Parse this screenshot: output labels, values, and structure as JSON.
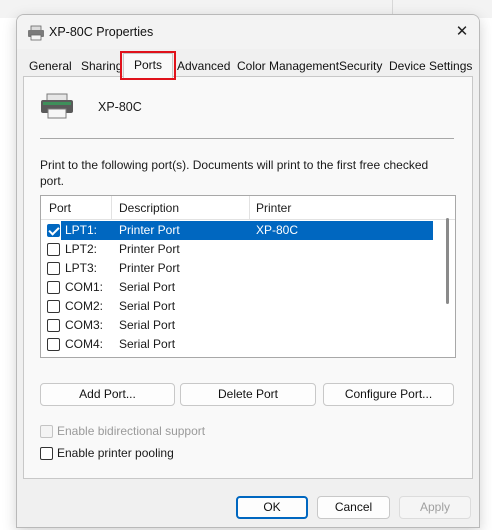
{
  "window": {
    "title": "XP-80C Properties",
    "close_glyph": "✕"
  },
  "tabs": [
    {
      "label": "General",
      "active": false
    },
    {
      "label": "Sharing",
      "active": false
    },
    {
      "label": "Ports",
      "active": true
    },
    {
      "label": "Advanced",
      "active": false
    },
    {
      "label": "Color Management",
      "active": false
    },
    {
      "label": "Security",
      "active": false
    },
    {
      "label": "Device Settings",
      "active": false
    }
  ],
  "highlight_color": "#e0121b",
  "accent_color": "#0067c0",
  "printer": {
    "name": "XP-80C",
    "icon": "printer-icon"
  },
  "description": "Print to the following port(s). Documents will print to the first free checked port.",
  "ports_table": {
    "headers": {
      "port": "Port",
      "description": "Description",
      "printer": "Printer"
    },
    "rows": [
      {
        "port": "LPT1:",
        "description": "Printer Port",
        "printer": "XP-80C",
        "checked": true,
        "selected": true
      },
      {
        "port": "LPT2:",
        "description": "Printer Port",
        "printer": "",
        "checked": false,
        "selected": false
      },
      {
        "port": "LPT3:",
        "description": "Printer Port",
        "printer": "",
        "checked": false,
        "selected": false
      },
      {
        "port": "COM1:",
        "description": "Serial Port",
        "printer": "",
        "checked": false,
        "selected": false
      },
      {
        "port": "COM2:",
        "description": "Serial Port",
        "printer": "",
        "checked": false,
        "selected": false
      },
      {
        "port": "COM3:",
        "description": "Serial Port",
        "printer": "",
        "checked": false,
        "selected": false
      },
      {
        "port": "COM4:",
        "description": "Serial Port",
        "printer": "",
        "checked": false,
        "selected": false
      }
    ]
  },
  "port_buttons": {
    "add": "Add Port...",
    "delete": "Delete Port",
    "configure": "Configure Port..."
  },
  "options": {
    "bidirectional": {
      "label": "Enable bidirectional support",
      "checked": false,
      "disabled": true
    },
    "pooling": {
      "label": "Enable printer pooling",
      "checked": false,
      "disabled": false
    }
  },
  "footer": {
    "ok": "OK",
    "cancel": "Cancel",
    "apply": "Apply"
  }
}
